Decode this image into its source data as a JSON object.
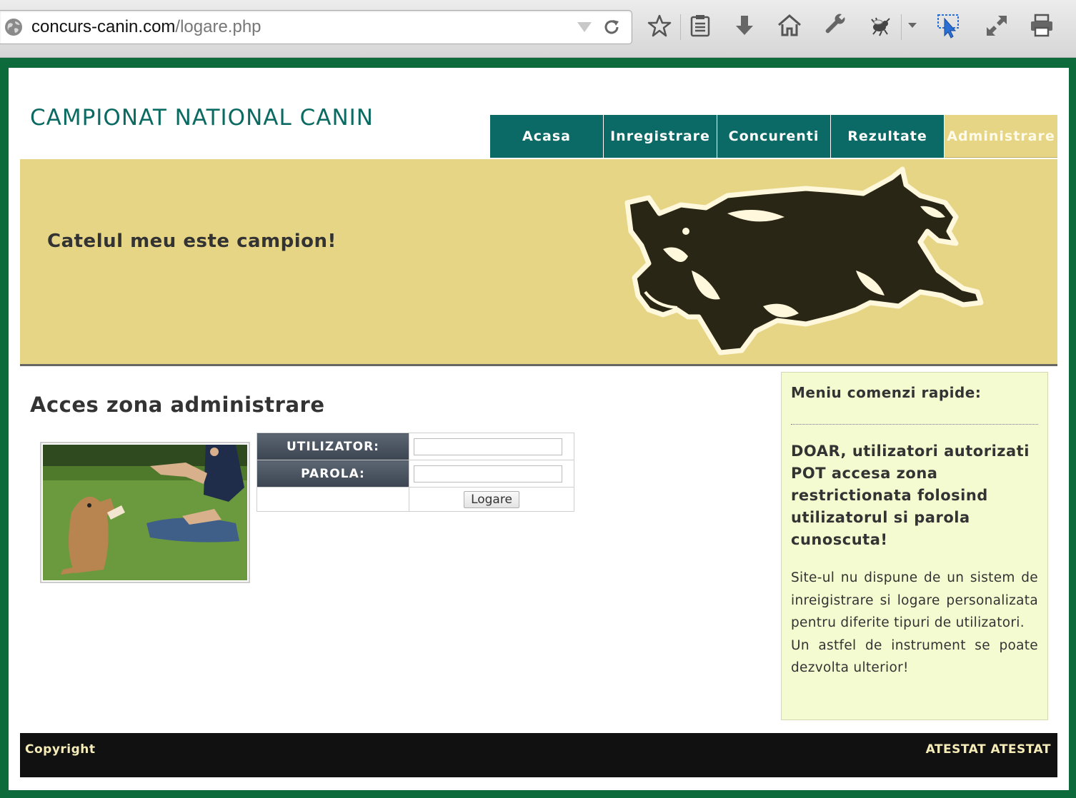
{
  "browser": {
    "url_host": "concurs-canin.com",
    "url_path": "/logare.php"
  },
  "site": {
    "title": "CAMPIONAT NATIONAL CANIN",
    "nav": [
      {
        "label": "Acasa"
      },
      {
        "label": "Inregistrare"
      },
      {
        "label": "Concurenti"
      },
      {
        "label": "Rezultate"
      },
      {
        "label": "Administrare",
        "active": true
      }
    ],
    "banner_tagline": "Catelul meu este campion!"
  },
  "main": {
    "heading": "Acces zona administrare",
    "login": {
      "user_label": "UTILIZATOR:",
      "user_value": "",
      "password_label": "PAROLA:",
      "password_value": "",
      "submit_label": "Logare"
    }
  },
  "sidebar": {
    "title": "Meniu comenzi rapide:",
    "notice": "DOAR, utilizatori autorizati POT accesa zona restrictionata folosind utilizatorul si parola cunoscuta!",
    "text_1": "Site-ul nu dispune de un sistem de inreigistrare si logare personalizata pentru diferite tipuri de utilizatori.",
    "text_2": "Un astfel de instrument se poate dezvolta ulterior!"
  },
  "footer": {
    "left": "Copyright",
    "right": "ATESTAT ATESTAT"
  },
  "colors": {
    "page_border": "#0d6b3b",
    "nav_bg": "#0b6a66",
    "accent_gold": "#e6d585",
    "sidebar_bg": "#f5fbd0",
    "footer_bg": "#111111"
  },
  "icons": [
    "globe-icon",
    "reload-icon",
    "bookmark-star-icon",
    "reading-list-icon",
    "download-icon",
    "home-icon",
    "wrench-icon",
    "bug-icon",
    "dropdown-arrow-icon",
    "cursor-select-icon",
    "fullscreen-icon",
    "print-icon"
  ]
}
